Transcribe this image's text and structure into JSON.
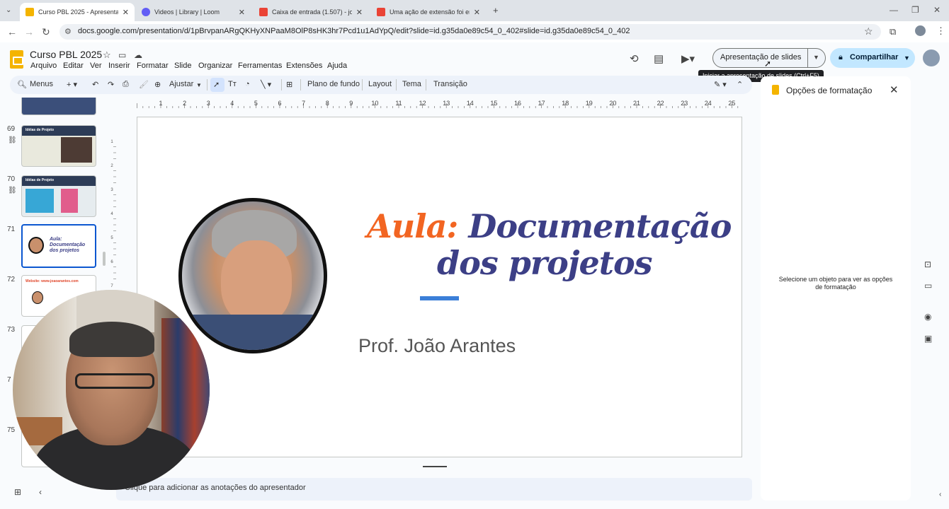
{
  "browser": {
    "tabs": [
      {
        "label": "Curso PBL 2025 - Apresentaçã",
        "active": true,
        "favicon": "google-slides-icon"
      },
      {
        "label": "Videos | Library | Loom",
        "active": false,
        "favicon": "loom-icon"
      },
      {
        "label": "Caixa de entrada (1.507) - joao",
        "active": false,
        "favicon": "gmail-icon"
      },
      {
        "label": "Uma ação de extensão foi envia",
        "active": false,
        "favicon": "gmail-icon"
      }
    ],
    "url": "docs.google.com/presentation/d/1pBrvpanARgQKHyXNPaaM8OlP8sHK3hr7Pcd1u1AdYpQ/edit?slide=id.g35da0e89c54_0_402#slide=id.g35da0e89c54_0_402"
  },
  "docs": {
    "title": "Curso PBL 2025",
    "menus": [
      "Arquivo",
      "Editar",
      "Ver",
      "Inserir",
      "Formatar",
      "Slide",
      "Organizar",
      "Ferramentas",
      "Extensões",
      "Ajuda"
    ],
    "present_label": "Apresentação de slides",
    "share_label": "Compartilhar",
    "tooltip": "Iniciar a apresentação de slides (Ctrl+F5)"
  },
  "toolbar": {
    "search_label": "Menus",
    "zoom_label": "Ajustar",
    "background_label": "Plano de fundo",
    "layout_label": "Layout",
    "theme_label": "Tema",
    "transition_label": "Transição"
  },
  "filmstrip": {
    "slides": [
      {
        "num": "69",
        "title": "Idéias de Projeto"
      },
      {
        "num": "70",
        "title": "Idéias de Projeto"
      },
      {
        "num": "71",
        "title": "Aula: Documentação dos projetos",
        "selected": true
      },
      {
        "num": "72",
        "title": "Website: www.joaoarantes.com"
      },
      {
        "num": "73",
        "title": ""
      },
      {
        "num": "7",
        "title": ""
      },
      {
        "num": "75",
        "title": ""
      }
    ]
  },
  "ruler": {
    "ticks": [
      "1",
      "2",
      "3",
      "4",
      "5",
      "6",
      "7",
      "8",
      "9",
      "10",
      "11",
      "12",
      "13",
      "14",
      "15",
      "16",
      "17",
      "18",
      "19",
      "20",
      "21",
      "22",
      "23",
      "24",
      "25"
    ],
    "vticks": [
      "1",
      "2",
      "3",
      "4",
      "5",
      "6",
      "7",
      "8",
      "9",
      "10",
      "11",
      "12",
      "13"
    ]
  },
  "slide": {
    "title_part1": "Aula:",
    "title_part2": "Documentação",
    "title_line2": "dos projetos",
    "author": "Prof. João Arantes",
    "colors": {
      "accent": "#f26522",
      "title": "#3c3f86",
      "bar": "#3b7fd8"
    }
  },
  "notes": {
    "placeholder": "Clique para adicionar as anotações do apresentador"
  },
  "format_panel": {
    "title": "Opções de formatação",
    "hint": "Selecione um objeto para ver as opções de formatação"
  }
}
